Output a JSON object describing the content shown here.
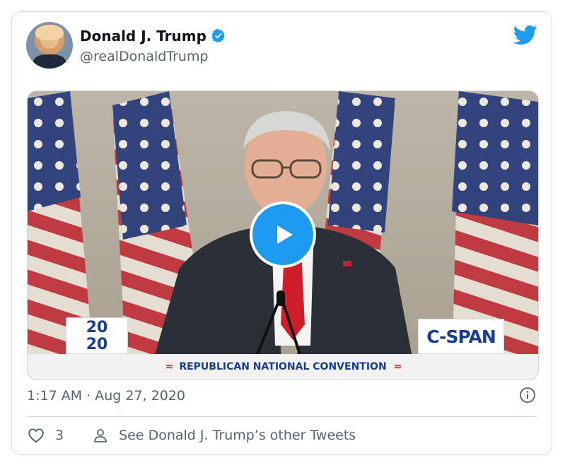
{
  "tweet": {
    "author_name": "Donald J. Trump",
    "author_handle": "@realDonaldTrump",
    "timestamp": "1:17 AM · Aug 27, 2020",
    "like_count": "3",
    "other_tweets_link": "See Donald J. Trump’s other Tweets"
  },
  "video": {
    "logo_top": "20",
    "logo_bottom": "20",
    "network_logo": "C-SPAN",
    "banner_text": "REPUBLICAN NATIONAL CONVENTION"
  },
  "colors": {
    "accent": "#1d9bf0",
    "text_secondary": "#536471",
    "border": "#cfd9de"
  },
  "icons": [
    "verified-badge-icon",
    "twitter-bird-icon",
    "play-icon",
    "info-icon",
    "heart-icon",
    "person-icon"
  ]
}
